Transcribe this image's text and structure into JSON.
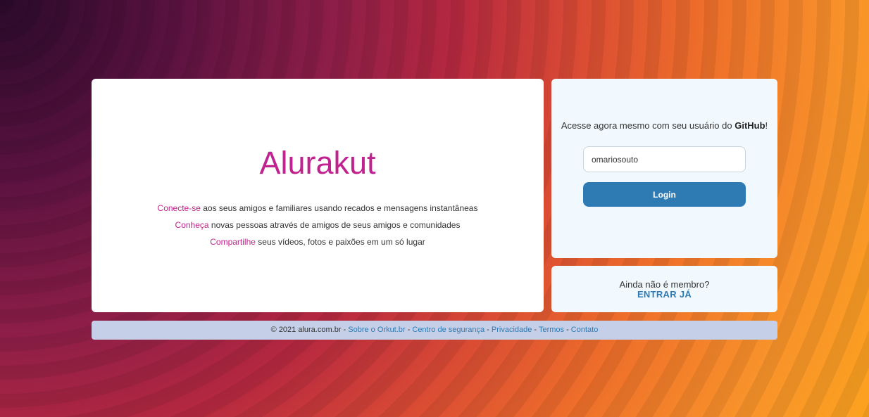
{
  "branding": {
    "logo_text": "Alurakut",
    "brand_color": "#c0238f"
  },
  "taglines": [
    {
      "highlight": "Conecte-se",
      "rest": " aos seus amigos e familiares usando recados e mensagens instantâneas"
    },
    {
      "highlight": "Conheça",
      "rest": " novas pessoas através de amigos de seus amigos e comunidades"
    },
    {
      "highlight": "Compartilhe",
      "rest": " seus vídeos, fotos e paixões em um só lugar"
    }
  ],
  "login_form": {
    "prompt_prefix": "Acesse agora mesmo com seu usuário do ",
    "prompt_brand": "GitHub",
    "prompt_suffix": "!",
    "username_value": "omariosouto",
    "login_label": "Login"
  },
  "signup": {
    "question": "Ainda não é membro?",
    "cta": "ENTRAR JÁ"
  },
  "footer": {
    "copyright": "© 2021 alura.com.br",
    "links": [
      "Sobre o Orkut.br",
      "Centro de segurança",
      "Privacidade",
      "Termos",
      "Contato"
    ],
    "separator": " - "
  },
  "colors": {
    "link": "#2e7bb4",
    "panel_bg": "#f1f9fe",
    "footer_bg": "#c5cfe7"
  }
}
